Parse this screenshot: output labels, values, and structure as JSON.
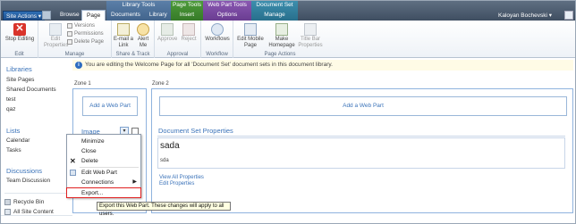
{
  "topbar": {
    "site_actions": "Site Actions ▾",
    "tabs": {
      "browse": "Browse",
      "page": "Page",
      "documents": "Documents",
      "library": "Library",
      "insert": "Insert",
      "options": "Options",
      "manage": "Manage"
    },
    "context_groups": {
      "library_tools": "Library Tools",
      "page_tools": "Page Tools",
      "web_part_tools": "Web Part Tools",
      "document_set": "Document Set"
    },
    "user": "Kaloyan Bochevski ▾"
  },
  "ribbon": {
    "edit": {
      "stop_editing": "Stop Editing",
      "group": "Edit"
    },
    "manage": {
      "edit_properties": "Edit Properties",
      "versions": "Versions",
      "permissions": "Permissions",
      "delete_page": "Delete Page",
      "group": "Manage"
    },
    "share": {
      "email_link": "E-mail a Link",
      "alert_me": "Alert Me",
      "group": "Share & Track"
    },
    "approval": {
      "approve": "Approve",
      "reject": "Reject",
      "group": "Approval"
    },
    "workflow": {
      "workflows": "Workflows",
      "group": "Workflow"
    },
    "page_actions": {
      "edit_mobile": "Edit Mobile Page",
      "make_homepage": "Make Homepage",
      "title_bar": "Title Bar Properties",
      "group": "Page Actions"
    }
  },
  "leftnav": {
    "libraries": "Libraries",
    "library_items": [
      "Site Pages",
      "Shared Documents",
      "test",
      "qaz"
    ],
    "lists": "Lists",
    "list_items": [
      "Calendar",
      "Tasks"
    ],
    "discussions": "Discussions",
    "discussion_items": [
      "Team Discussion"
    ],
    "recycle_bin": "Recycle Bin",
    "all_site_content": "All Site Content"
  },
  "info": {
    "text": "You are editing the Welcome Page for all 'Document Set' document sets in this document library."
  },
  "zones": {
    "zone1_label": "Zone 1",
    "zone2_label": "Zone 2",
    "add_web_part": "Add a Web Part",
    "image_title": "Image",
    "doc_set_title": "Document Set Properties",
    "doc_name": "sada",
    "doc_sub": "sda",
    "view_all": "View All Properties",
    "edit_props": "Edit Properties"
  },
  "menu": {
    "minimize": "Minimize",
    "close": "Close",
    "delete": "Delete",
    "edit_web_part": "Edit Web Part",
    "connections": "Connections",
    "export": "Export..."
  },
  "tooltip": "Export this Web Part. These changes will apply to all users."
}
